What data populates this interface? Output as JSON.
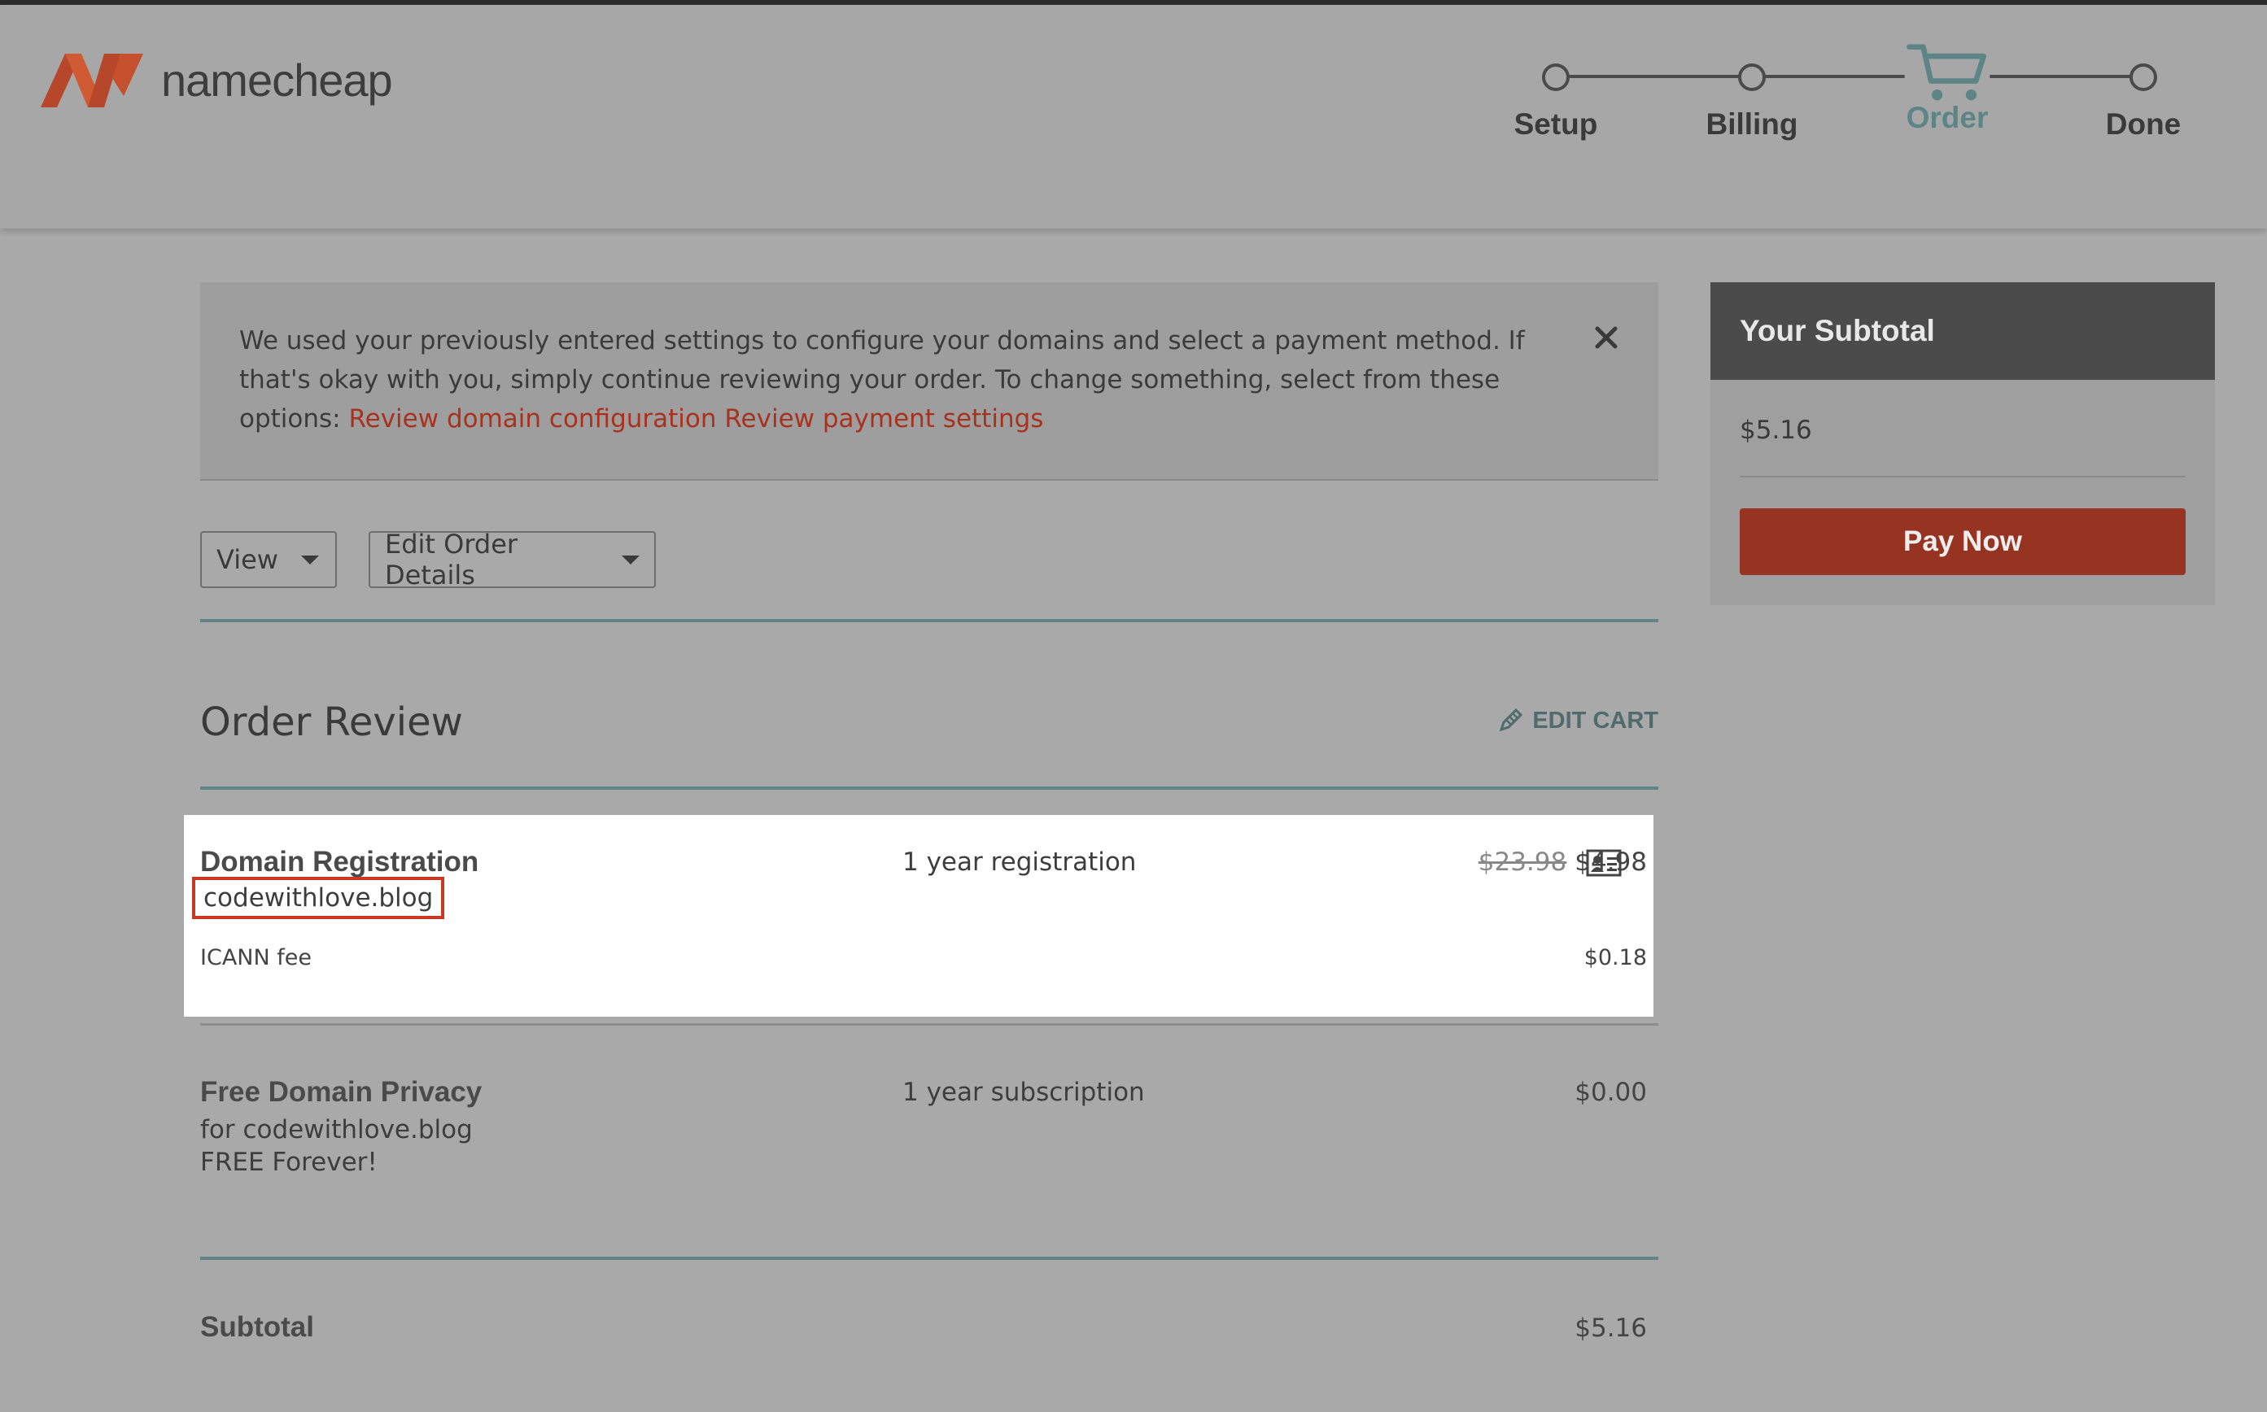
{
  "brand": {
    "name": "namecheap",
    "accent": "#c84b27"
  },
  "steps": [
    {
      "label": "Setup",
      "state": "complete"
    },
    {
      "label": "Billing",
      "state": "complete"
    },
    {
      "label": "Order",
      "state": "active"
    },
    {
      "label": "Done",
      "state": "pending"
    }
  ],
  "notice": {
    "text": "We used your previously entered settings to configure your domains and select a payment method. If that's okay with you, simply continue reviewing your order. To change something, select from these options: ",
    "link_domain": "Review domain configuration",
    "link_payment": "Review payment settings",
    "close_icon": "close-icon"
  },
  "toolbar": {
    "view_label": "View",
    "edit_label": "Edit Order Details"
  },
  "order": {
    "title": "Order Review",
    "edit_cart_label": "EDIT CART",
    "items": [
      {
        "title": "Domain Registration",
        "domain": "codewithlove.blog",
        "term": "1 year registration",
        "old_price": "$23.98",
        "price": "$4.98",
        "fee_label": "ICANN fee",
        "fee_price": "$0.18",
        "icon": "contact-card-icon"
      },
      {
        "title": "Free Domain Privacy",
        "sub1": "for codewithlove.blog",
        "sub2": "FREE Forever!",
        "term": "1 year subscription",
        "price": "$0.00"
      }
    ],
    "subtotal_label": "Subtotal",
    "subtotal_value": "$5.16"
  },
  "sidebar": {
    "title": "Your Subtotal",
    "amount": "$5.16",
    "pay_label": "Pay Now"
  }
}
